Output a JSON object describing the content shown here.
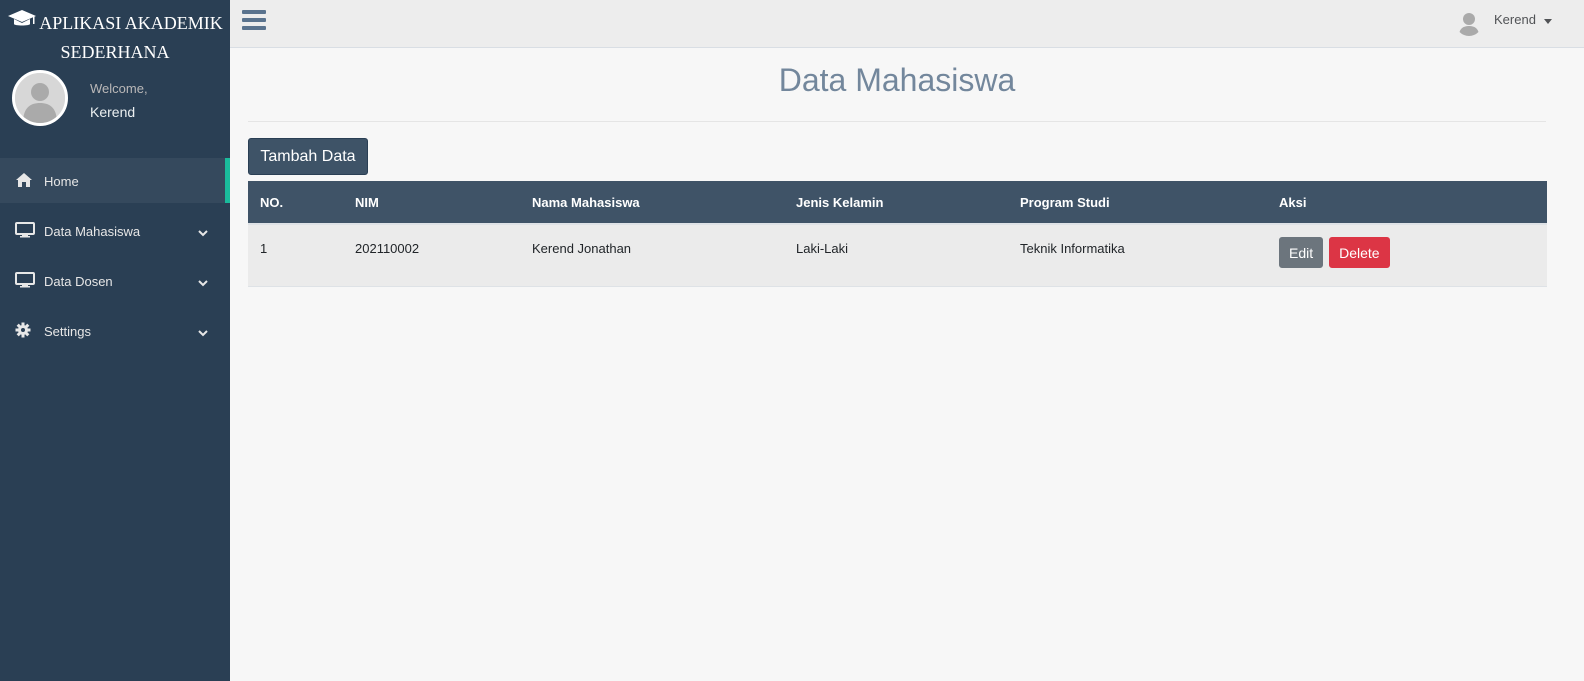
{
  "app": {
    "title_line1": "APLIKASI AKADEMIK",
    "title_line2": "SEDERHANA",
    "icon": "graduation-cap-icon"
  },
  "profile": {
    "welcome": "Welcome,",
    "name": "Kerend"
  },
  "sidebar": {
    "items": [
      {
        "label": "Home",
        "icon": "home-icon",
        "active": true,
        "has_submenu": false
      },
      {
        "label": "Data Mahasiswa",
        "icon": "desktop-icon",
        "active": false,
        "has_submenu": true
      },
      {
        "label": "Data Dosen",
        "icon": "desktop-icon",
        "active": false,
        "has_submenu": true
      },
      {
        "label": "Settings",
        "icon": "gear-icon",
        "active": false,
        "has_submenu": true
      }
    ]
  },
  "topnav": {
    "user_name": "Kerend"
  },
  "main": {
    "title": "Data Mahasiswa",
    "add_button": "Tambah Data"
  },
  "table": {
    "headers": [
      "NO.",
      "NIM",
      "Nama Mahasiswa",
      "Jenis Kelamin",
      "Program Studi",
      "Aksi"
    ],
    "rows": [
      {
        "no": "1",
        "nim": "202110002",
        "nama": "Kerend Jonathan",
        "jk": "Laki-Laki",
        "prodi": "Teknik Informatika",
        "edit": "Edit",
        "delete": "Delete"
      }
    ]
  },
  "colors": {
    "sidebar_bg": "#2a3f54",
    "active_accent": "#1abb9c",
    "table_header": "#3f5367",
    "edit_btn": "#6c757d",
    "delete_btn": "#dc3545"
  }
}
